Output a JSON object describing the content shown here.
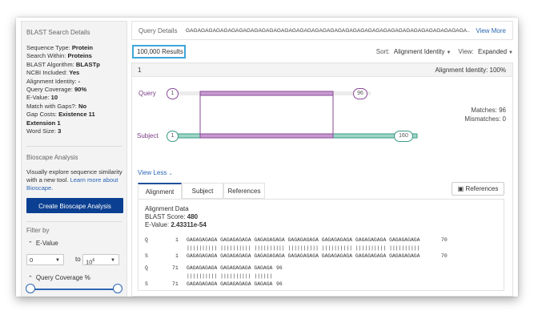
{
  "sidebar": {
    "title": "BLAST Search Details",
    "params": [
      {
        "label": "Sequence Type: ",
        "value": "Protein"
      },
      {
        "label": "Search Within: ",
        "value": "Proteins"
      },
      {
        "label": "BLAST Algorithm: ",
        "value": "BLASTp"
      },
      {
        "label": "NCBI Included: ",
        "value": "Yes"
      },
      {
        "label": "Alignment Identity: ",
        "value": "-"
      },
      {
        "label": "Query Coverage: ",
        "value": "90%"
      },
      {
        "label": "E-Value: ",
        "value": "10"
      },
      {
        "label": "Match with Gaps?: ",
        "value": "No"
      },
      {
        "label": "Gap Costs: ",
        "value": "Existence 11 Extension 1"
      },
      {
        "label": "Word Size: ",
        "value": "3"
      }
    ],
    "bioscape_title": "Bioscape Analysis",
    "bioscape_text": "Visually explore sequence similarity with a new tool.",
    "bioscape_link": "Learn more about Bioscape.",
    "bioscape_button": "Create Bioscape Analysis",
    "filter_title": "Filter by",
    "evalue_label": "E-Value",
    "evalue_from": "0",
    "evalue_to_sep": "to",
    "evalue_to_base": "10",
    "evalue_to_exp": "6",
    "coverage_label": "Query Coverage %"
  },
  "main": {
    "query_details_label": "Query Details",
    "query_sequence": "GAGAGAGAGAGAGAGAGAGAGAGAGAGAGAGAGAGAGAGAGAGAGAGAGAGAGAGAGAGAGAGAGAGAGAGAGA...",
    "view_more": "View More",
    "results_count": "100,000 Results",
    "sort_label": "Sort:",
    "sort_value": "Alignment Identity",
    "view_label": "View:",
    "view_value": "Expanded",
    "result": {
      "index": "1",
      "alignment_identity": "Alignment Identity: 100%",
      "query_label": "Query",
      "subject_label": "Subject",
      "query_start": "1",
      "query_end": "96",
      "subject_start": "1",
      "subject_end": "160",
      "matches": "Matches: 96",
      "mismatches": "Mismatches: 0",
      "view_less": "View Less",
      "tabs": [
        "Alignment",
        "Subject",
        "References"
      ],
      "references_button": "References",
      "alignment_data_title": "Alignment Data",
      "blast_score_label": "BLAST Score: ",
      "blast_score": "480",
      "evalue_label": "E-Value: ",
      "evalue": "2.43311e-54",
      "lines": [
        {
          "tag": "Q",
          "start": "1",
          "seq": "GAGAGAGAGA GAGAGAGAGA GAGAGAGAGA GAGAGAGAGA GAGAGAGAGA GAGAGAGAGA GAGAGAGAGA",
          "end": "70"
        },
        {
          "tag": "",
          "start": "",
          "seq": "|||||||||| |||||||||| |||||||||| |||||||||| |||||||||| |||||||||| ||||||||||",
          "end": ""
        },
        {
          "tag": "S",
          "start": "1",
          "seq": "GAGAGAGAGA GAGAGAGAGA GAGAGAGAGA GAGAGAGAGA GAGAGAGAGA GAGAGAGAGA GAGAGAGAGA",
          "end": "70"
        },
        {
          "tag": "Q",
          "start": "71",
          "seq": "GAGAGAGAGA GAGAGAGAGA GAGAGA",
          "end": "96"
        },
        {
          "tag": "",
          "start": "",
          "seq": "|||||||||| |||||||||| ||||||",
          "end": ""
        },
        {
          "tag": "S",
          "start": "71",
          "seq": "GAGAGAGAGA GAGAGAGAGA GAGAGA",
          "end": "96"
        }
      ]
    }
  },
  "colors": {
    "primary_button": "#0b3f91",
    "link": "#2b65b3",
    "query_track": "#8a4a99",
    "subject_track": "#3a9a86",
    "highlight_box": "#3ea6d8"
  }
}
